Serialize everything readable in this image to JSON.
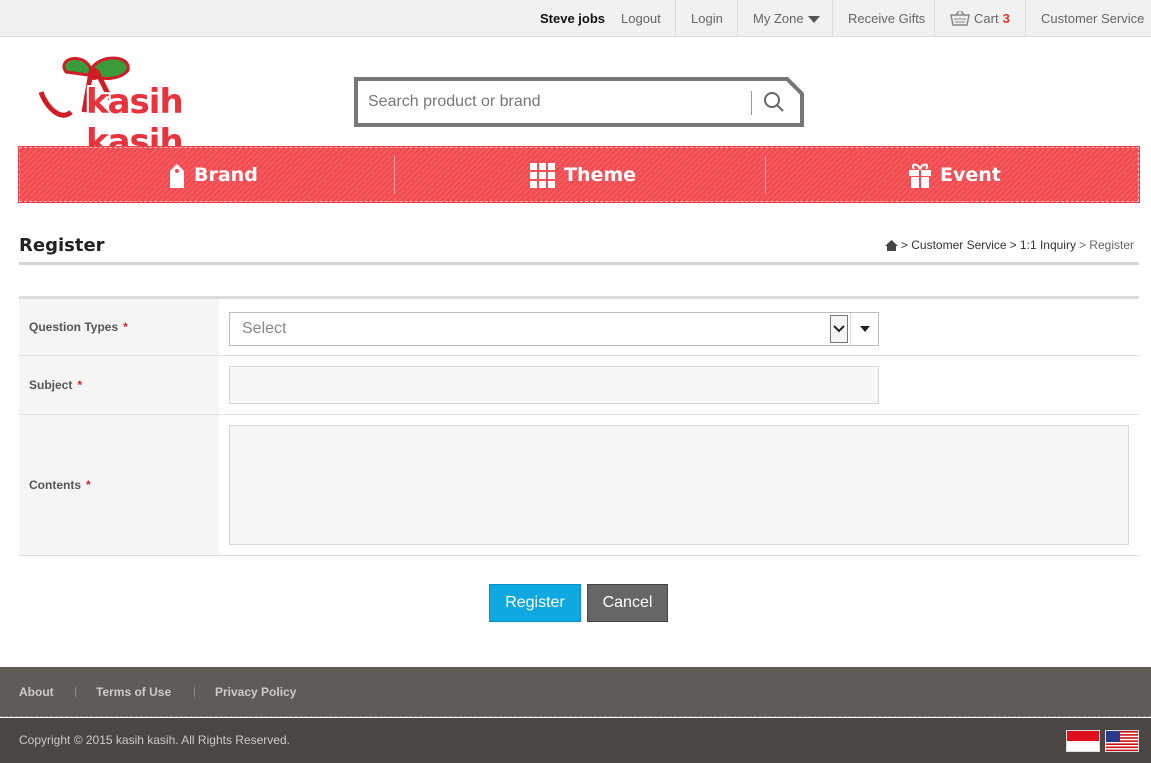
{
  "topbar": {
    "user": "Steve jobs",
    "logout": "Logout",
    "login": "Login",
    "my_zone": "My Zone",
    "receive_gifts": "Receive Gifts",
    "cart_label": "Cart",
    "cart_count": "3",
    "customer_service": "Customer Service"
  },
  "logo": {
    "text": "kasih kasih",
    "icon": "gift-ribbon-logo"
  },
  "search": {
    "placeholder": "Search product or brand",
    "icon": "search-icon"
  },
  "nav": {
    "items": [
      {
        "label": "Brand",
        "icon": "tag-icon"
      },
      {
        "label": "Theme",
        "icon": "grid-icon"
      },
      {
        "label": "Event",
        "icon": "gift-icon"
      }
    ],
    "color": "#f04b51"
  },
  "page": {
    "title": "Register",
    "breadcrumb": {
      "home_icon": "home-icon",
      "items": [
        "> Customer Service",
        "> 1:1 Inquiry",
        "> Register"
      ]
    }
  },
  "form": {
    "question_types": {
      "label": "Question Types",
      "value": "Select"
    },
    "subject": {
      "label": "Subject",
      "value": ""
    },
    "contents": {
      "label": "Contents",
      "value": ""
    },
    "required_mark": "*"
  },
  "buttons": {
    "register": "Register",
    "cancel": "Cancel"
  },
  "footer": {
    "links": [
      "About",
      "Terms of Use",
      "Privacy Policy"
    ],
    "copyright": "Copyright © 2015 kasih kasih. All Rights Reserved.",
    "flags": [
      "indonesia-flag-icon",
      "usa-flag-icon"
    ]
  },
  "colors": {
    "accent": "#0fa8e0",
    "brand_red": "#e8323c",
    "footer": "#5f5b57"
  }
}
